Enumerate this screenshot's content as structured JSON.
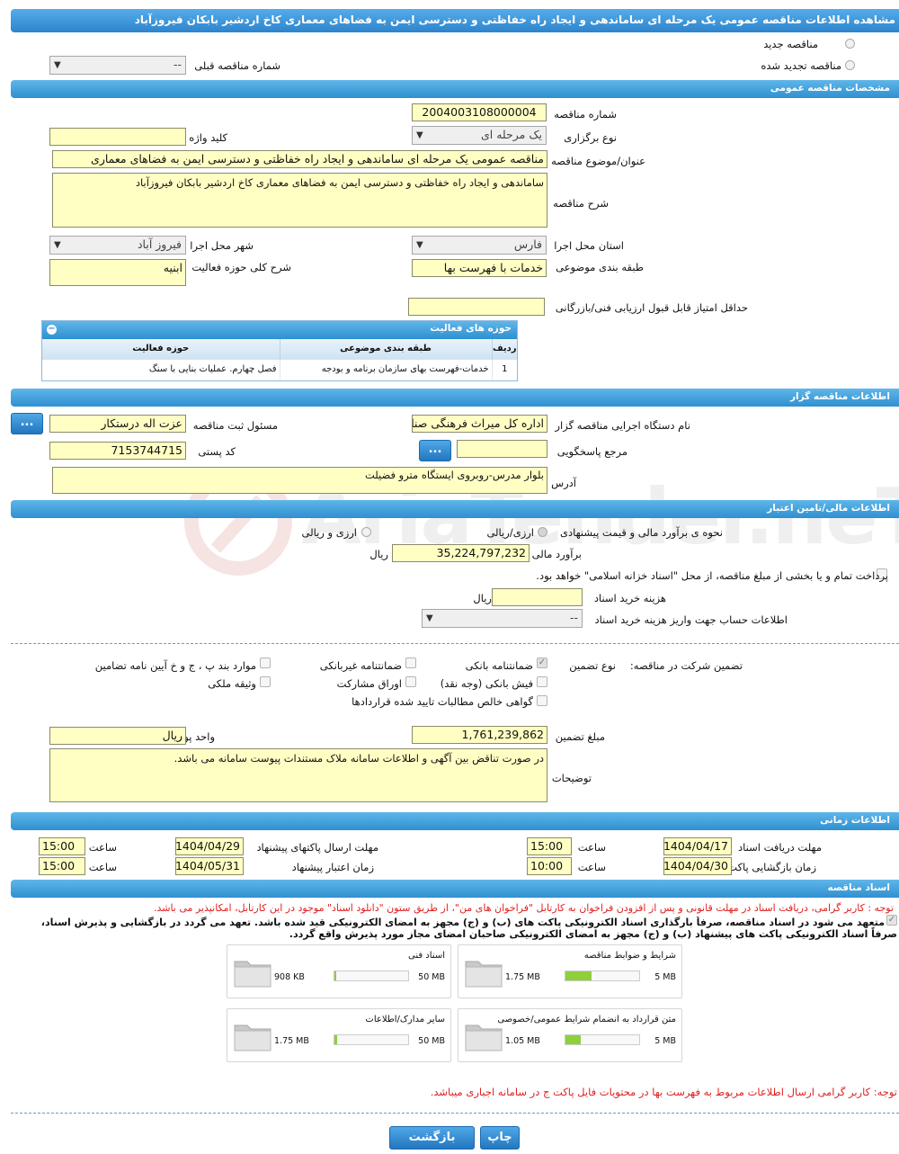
{
  "page_title": "مشاهده اطلاعات مناقصه عمومی یک مرحله ای ساماندهی و ایجاد راه خفاظتی و دسترسی ایمن به فضاهای معماری کاخ اردشیر بابکان فیروزآباد",
  "top": {
    "new_tender": "مناقصه جدید",
    "renewed_tender": "مناقصه تجدید شده",
    "prev_number_label": "شماره مناقصه قبلی",
    "prev_number_value": "--"
  },
  "general": {
    "header": "مشخصات مناقصه عمومی",
    "number_label": "شماره مناقصه",
    "number_value": "2004003108000004",
    "type_label": "نوع برگزاری",
    "type_value": "یک مرحله ای",
    "keyword_label": "کلید واژه",
    "subject_label": "عنوان/موضوع مناقصه",
    "subject_value": "مناقصه عمومی یک مرحله ای ساماندهی و ایجاد راه خفاظتی و دسترسی ایمن به فضاهای معماری",
    "desc_label": "شرح مناقصه",
    "desc_value": "ساماندهی و ایجاد راه خفاظتی و دسترسی ایمن به فضاهای معماری کاخ اردشیر بابکان فیروزآباد",
    "province_label": "استان محل اجرا",
    "province_value": "فارس",
    "city_label": "شهر محل اجرا",
    "city_value": "فیروز آباد",
    "category_label": "طبقه بندی موضوعی",
    "category_value": "خدمات با فهرست بها",
    "scope_label": "شرح کلی حوزه فعالیت",
    "scope_value": "ابنیه",
    "min_score_label": "حداقل امتیاز قابل قبول ارزیابی فنی/بازرگانی"
  },
  "activity": {
    "title": "حوزه های فعالیت",
    "col_row": "ردیف",
    "col_cat": "طبقه بندی موضوعی",
    "col_area": "حوزه فعالیت",
    "rows": [
      {
        "n": "1",
        "cat": "خدمات-فهرست بهای سازمان برنامه و بودجه",
        "area": "فصل چهارم. عملیات بنایی با سنگ"
      }
    ]
  },
  "org": {
    "header": "اطلاعات مناقصه گزار",
    "agency_label": "نام دستگاه اجرایی مناقصه گزار",
    "agency_value": "اداره کل میراث فرهنگی  صنایع",
    "registrar_label": "مسئول ثبت مناقصه",
    "registrar_value": "عزت اله درستکار",
    "ref_label": "مرجع پاسخگویی",
    "postal_label": "کد پستی",
    "postal_value": "7153744715",
    "address_label": "آدرس",
    "address_value": "بلوار مدرس-روبروی ایستگاه مترو فضیلت",
    "btn": "..."
  },
  "finance": {
    "header": "اطلاعات مالی/تامین اعتبار",
    "method_label": "نحوه ی برآورد مالی و قیمت پیشنهادی",
    "opt1": "ارزی/ریالی",
    "opt2": "ارزی و ریالی",
    "estimate_label": "برآورد مالی",
    "estimate_value": "35,224,797,232",
    "rial": "ریال",
    "treasury_text": "پرداخت تمام و یا بخشی از مبلغ مناقصه، از محل \"اسناد خزانه اسلامی\" خواهد بود.",
    "doc_cost_label": "هزینه خرید اسناد",
    "doc_cost_unit": "ریال",
    "account_label": "اطلاعات حساب جهت واریز هزینه خرید اسناد",
    "account_value": "--"
  },
  "guarantee": {
    "title": "تضمین شرکت در مناقصه:",
    "type_label": "نوع تضمین",
    "bank": "ضمانتنامه بانکی",
    "nonbank": "ضمانتنامه غیربانکی",
    "items_ppj": "موارد بند پ ، ج و خ آیین نامه تضامین",
    "cash": "فیش بانکی (وجه نقد)",
    "bonds": "اوراق مشارکت",
    "property": "وثیقه ملکی",
    "receivables": "گواهی خالص مطالبات تایید شده قراردادها",
    "amount_label": "مبلغ تضمین",
    "amount_value": "1,761,239,862",
    "currency_label": "واحد پول",
    "currency_value": "ریال",
    "notes_label": "توضیحات",
    "notes_value": "در صورت تناقض بین آگهی و اطلاعات سامانه ملاک مستندات پیوست سامانه می باشد."
  },
  "timing": {
    "header": "اطلاعات زمانی",
    "doc_deadline_label": "مهلت دریافت اسناد",
    "doc_deadline_date": "1404/04/17",
    "doc_deadline_time": "15:00",
    "submit_deadline_label": "مهلت ارسال پاکتهای پیشنهاد",
    "submit_deadline_date": "1404/04/29",
    "submit_deadline_time": "15:00",
    "opening_label": "زمان بازگشایی پاکت ها",
    "opening_date": "1404/04/30",
    "opening_time": "10:00",
    "validity_label": "زمان اعتبار پیشنهاد",
    "validity_date": "1404/05/31",
    "validity_time": "15:00",
    "time_label": "ساعت"
  },
  "docs": {
    "header": "اسناد مناقصه",
    "note1": "توجه : کاربر گرامی، دریافت اسناد در مهلت قانونی و پس از افزودن فراخوان به کارتابل \"فراخوان های من\"، از طریق ستون \"دانلود اسناد\" موجود در این کارتابل، امکانپذیر می باشد.",
    "commit_line1": "متعهد می شود در اسناد مناقصه، صرفاً بارگذاری اسناد الکترونیکی پاکت های (ب) و (ج) مجهز به امضای الکترونیکی قید شده باشد. تعهد می گردد در بازگشایی و پذیرش اسناد،",
    "commit_line2": "صرفاً اسناد الکترونیکی پاکت های پیشنهاد (ب) و (ج) مجهز به امضای الکترونیکی صاحبان امضای مجاز مورد پذیرش واقع گردد.",
    "files": [
      {
        "name": "شرایط و ضوابط مناقصه",
        "size": "1.75 MB",
        "max": "5 MB",
        "ratio": 0.35
      },
      {
        "name": "اسناد فنی",
        "size": "908 KB",
        "max": "50 MB",
        "ratio": 0.02
      },
      {
        "name": "متن قرارداد به انضمام شرایط عمومی/خصوصی",
        "size": "1.05 MB",
        "max": "5 MB",
        "ratio": 0.21
      },
      {
        "name": "سایر مدارک/اطلاعات",
        "size": "1.75 MB",
        "max": "50 MB",
        "ratio": 0.035
      }
    ],
    "note2": "توجه: کاربر گرامی ارسال اطلاعات مربوط به فهرست بها در محتویات فایل پاکت ج در سامانه اجباری میباشد."
  },
  "buttons": {
    "print": "چاپ",
    "back": "بازگشت"
  },
  "watermark": "AriaTender.neT",
  "colors": {
    "header": "#3a97d8",
    "field": "#ffffc4",
    "note": "#e02020",
    "progress": "#8fcf3c"
  }
}
